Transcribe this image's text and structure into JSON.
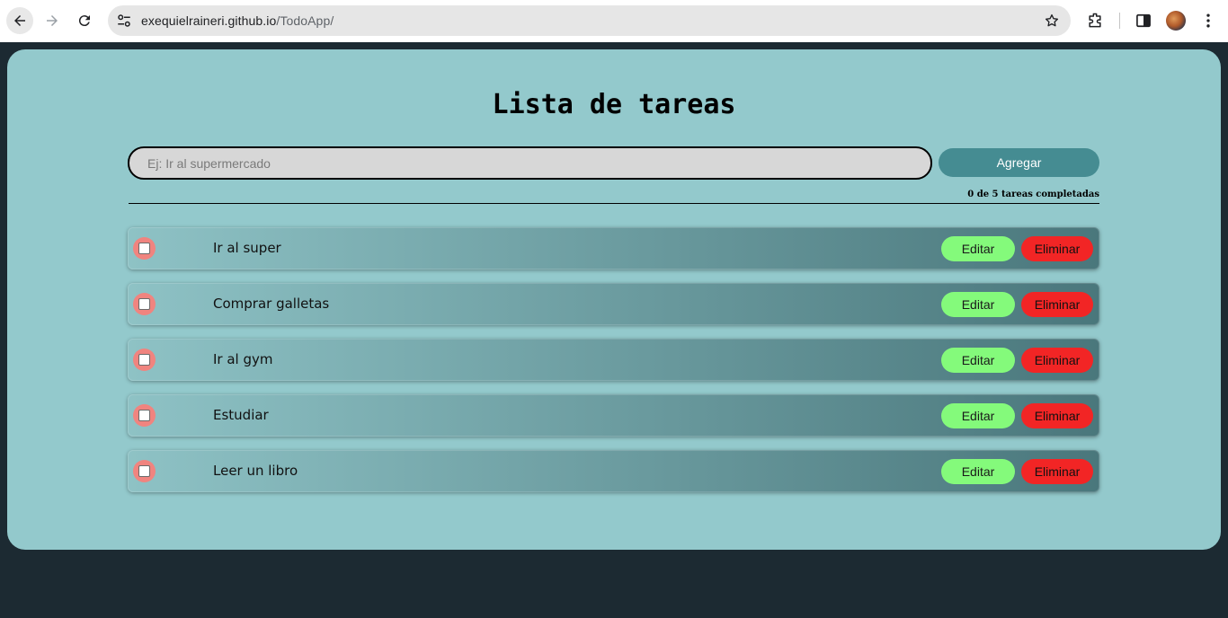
{
  "browser": {
    "url_domain": "exequielraineri.github.io",
    "url_path": "/TodoApp/",
    "icons": [
      "back-arrow-icon",
      "forward-arrow-icon",
      "reload-icon",
      "site-settings-icon",
      "bookmark-star-icon",
      "extensions-icon",
      "side-panel-icon",
      "profile-avatar",
      "kebab-menu-icon"
    ]
  },
  "app": {
    "title": "Lista de tareas",
    "input": {
      "placeholder": "Ej: Ir al supermercado",
      "value": ""
    },
    "add_label": "Agregar",
    "counter_text": "0 de 5 tareas completadas",
    "tasks": [
      {
        "label": "Ir al super",
        "completed": false,
        "edit_label": "Editar",
        "delete_label": "Eliminar"
      },
      {
        "label": "Comprar galletas",
        "completed": false,
        "edit_label": "Editar",
        "delete_label": "Eliminar"
      },
      {
        "label": "Ir al gym",
        "completed": false,
        "edit_label": "Editar",
        "delete_label": "Eliminar"
      },
      {
        "label": "Estudiar",
        "completed": false,
        "edit_label": "Editar",
        "delete_label": "Eliminar"
      },
      {
        "label": "Leer un libro",
        "completed": false,
        "edit_label": "Editar",
        "delete_label": "Eliminar"
      }
    ]
  },
  "colors": {
    "page_background": "#1c2a32",
    "card_background": "#93c9cc",
    "add_button": "#458c92",
    "edit_button": "#84fa7b",
    "delete_button": "#f22525",
    "checkbox_ring": "#f0847f",
    "task_gradient_start": "#8ec2c5",
    "task_gradient_end": "#4a777c"
  }
}
